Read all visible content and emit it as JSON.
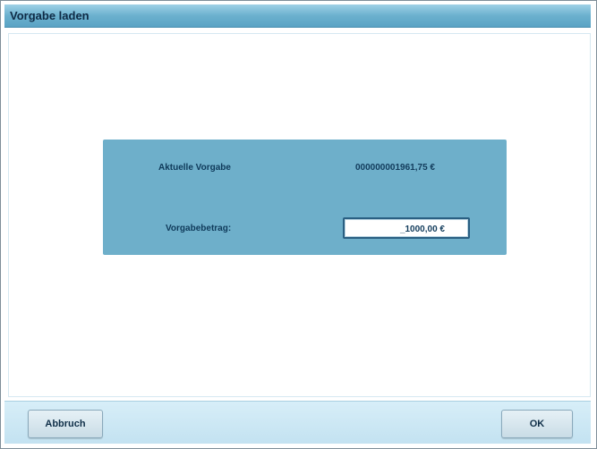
{
  "window": {
    "title": "Vorgabe laden"
  },
  "form": {
    "current_label": "Aktuelle Vorgabe",
    "current_value": "000000001961,75 €",
    "amount_label": "Vorgabebetrag:",
    "amount_value": "_1000,00 €"
  },
  "footer": {
    "cancel_label": "Abbruch",
    "ok_label": "OK"
  },
  "colors": {
    "titlebar": "#6bb0ce",
    "panel": "#6eafca",
    "footer": "#c3e2f1"
  }
}
